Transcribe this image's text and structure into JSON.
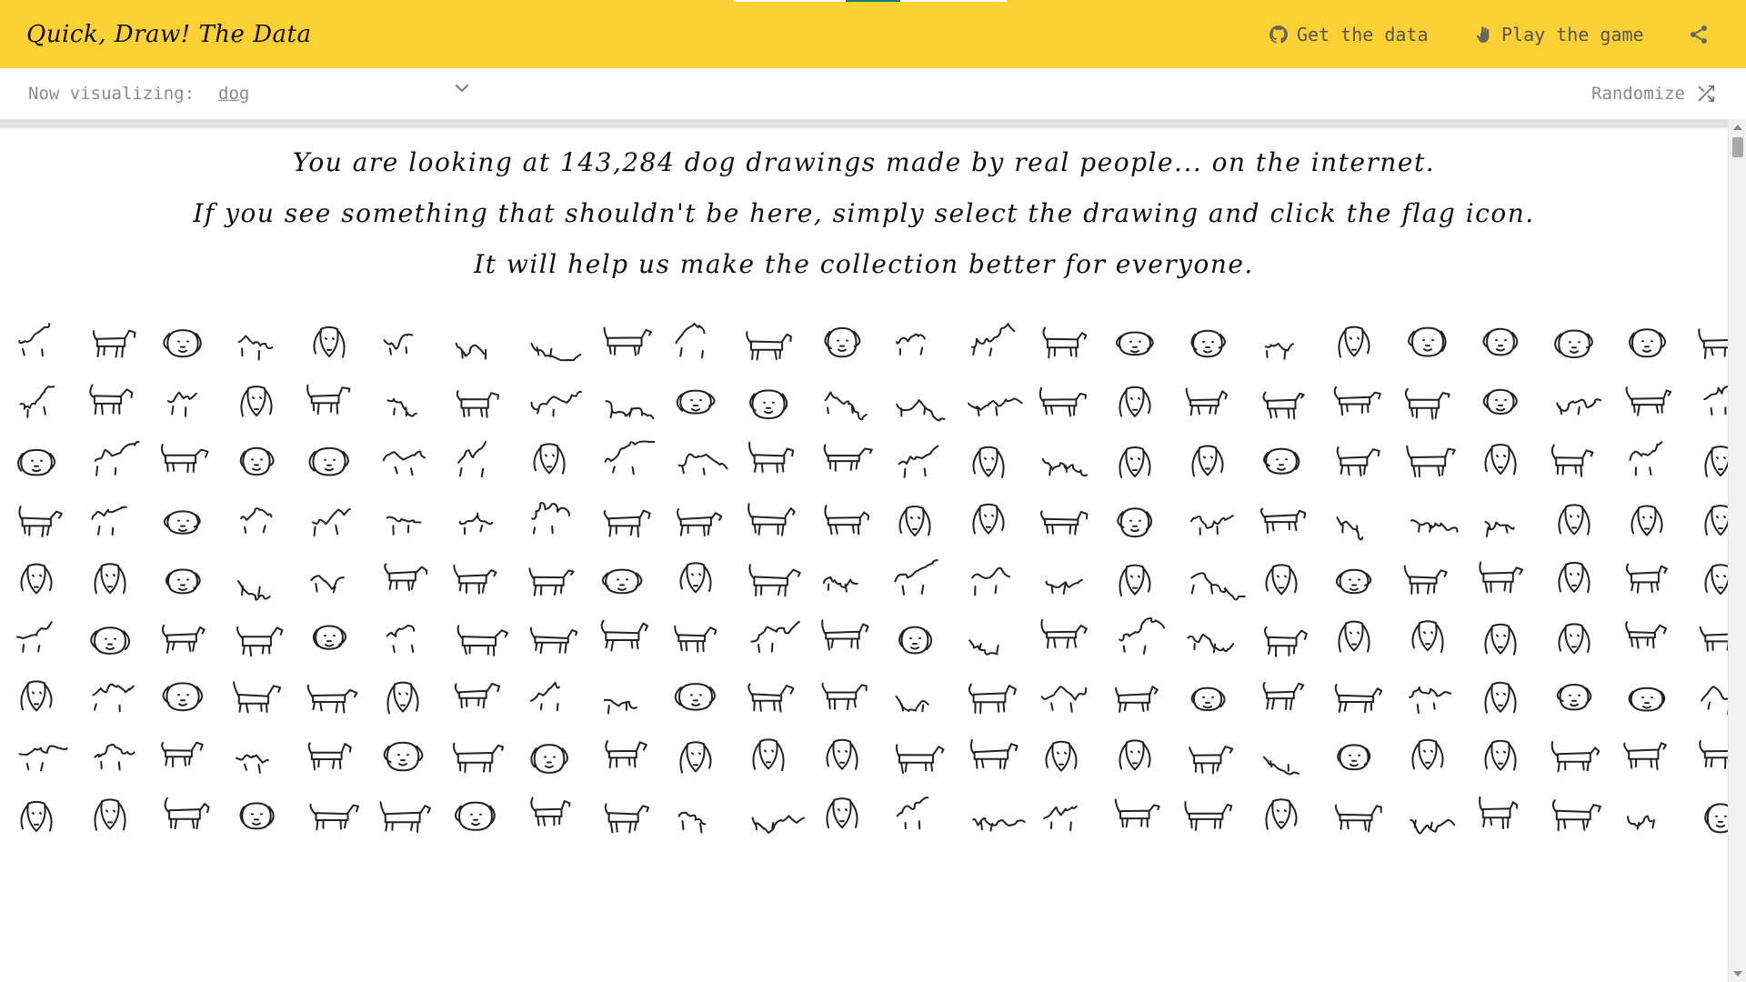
{
  "header": {
    "title": "Quick, Draw! The Data",
    "get_data_label": "Get the data",
    "play_game_label": "Play the game",
    "icons": [
      "github-icon",
      "hand-icon",
      "share-icon"
    ],
    "background_color": "#fdd034"
  },
  "controls": {
    "now_visualizing_label": "Now visualizing:",
    "selected_category": "dog",
    "randomize_label": "Randomize",
    "icons": [
      "chevron-down-icon",
      "shuffle-icon"
    ]
  },
  "intro": {
    "line1": "You are looking at 143,284 dog drawings made by real people... on the internet.",
    "line2": "If you see something that shouldn't be here, simply select the drawing and click the flag icon.",
    "line3": "It will help us make the collection better for everyone."
  },
  "grid": {
    "subject": "dog",
    "visible_rows": 9,
    "visible_columns": 24
  }
}
